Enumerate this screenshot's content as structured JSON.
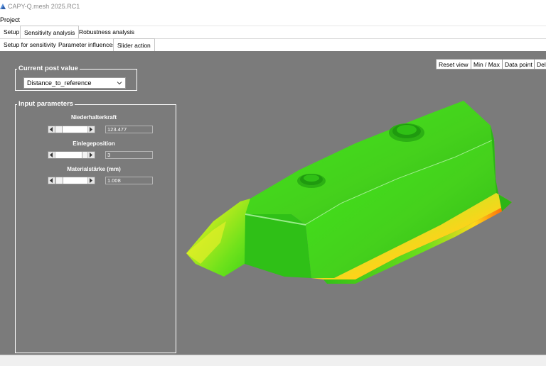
{
  "window": {
    "title": "CAPY-Q.mesh 2025.RC1"
  },
  "menu": {
    "items": [
      "Project"
    ]
  },
  "tabs_main": [
    {
      "label": "Setup",
      "active": false
    },
    {
      "label": "Sensitivity analysis",
      "active": true
    },
    {
      "label": "Robustness analysis",
      "active": false
    }
  ],
  "tabs_sub": [
    {
      "label": "Setup for sensitivity",
      "active": false
    },
    {
      "label": "Parameter influences",
      "active": false
    },
    {
      "label": "Slider action",
      "active": true
    }
  ],
  "post_value": {
    "group_title": "Current post value",
    "selected": "Distance_to_reference"
  },
  "input_parameters": {
    "group_title": "Input parameters",
    "params": [
      {
        "label": "Niederhalterkraft",
        "value": "123.477",
        "slider_position": 0.12
      },
      {
        "label": "Einlegeposition",
        "value": "3",
        "slider_position": 0.85
      },
      {
        "label": "Materialstärke (mm)",
        "value": "1.008",
        "slider_position": 0.14
      }
    ]
  },
  "toolbar": {
    "reset_view": "Reset view",
    "min_max": "Min / Max",
    "data_point": "Data point",
    "delete": "Dele"
  },
  "colors": {
    "viewport_bg": "#7b7b7b",
    "mesh_green": "#39e619",
    "mesh_red": "#ff3300"
  }
}
